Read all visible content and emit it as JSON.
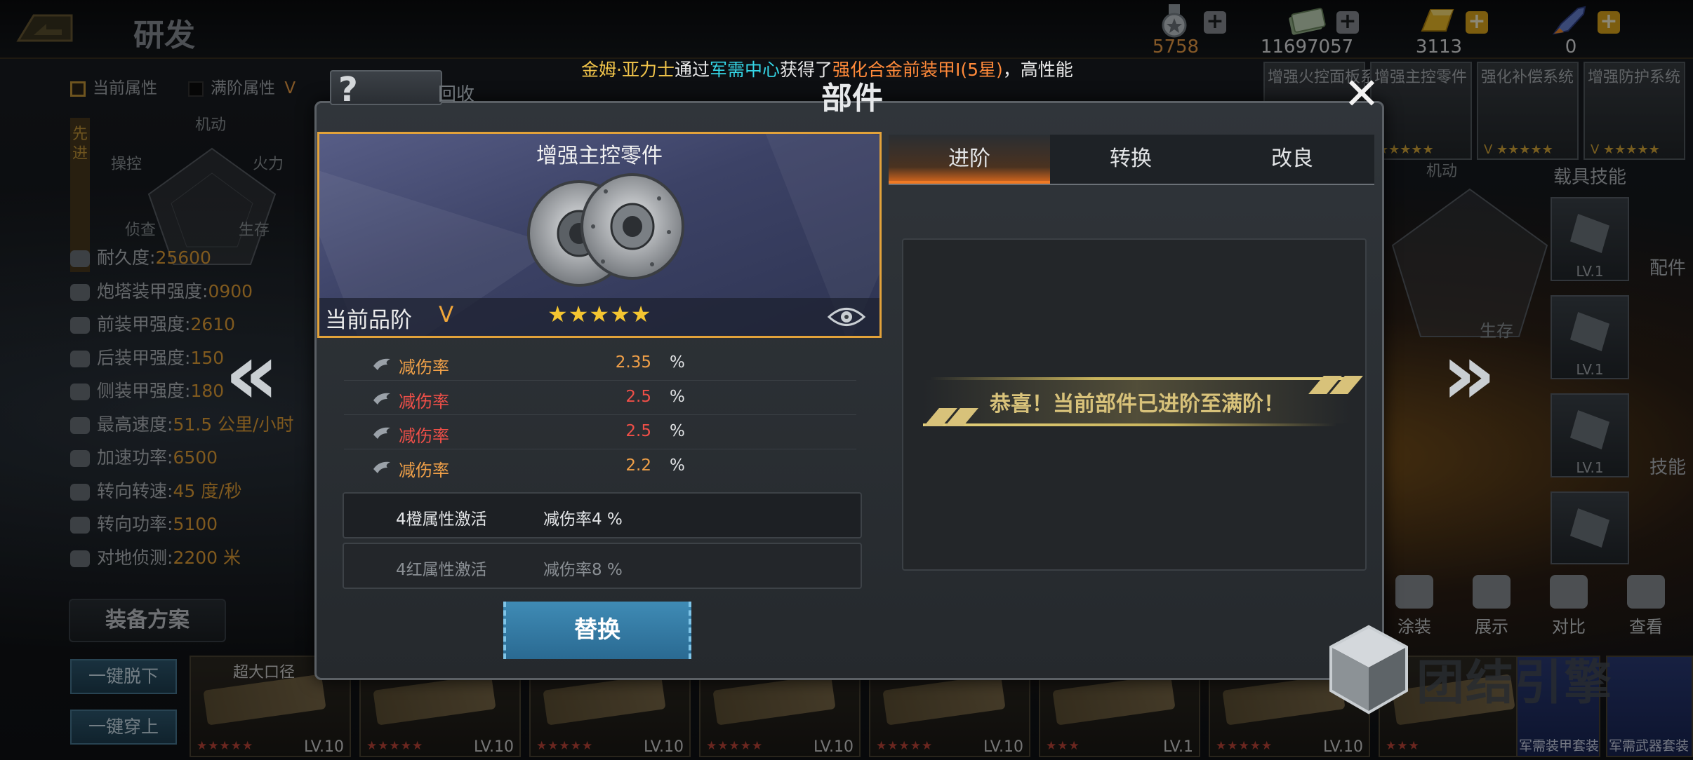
{
  "header": {
    "title": "研发"
  },
  "currencies": [
    {
      "icon": "medal-icon",
      "value": "5758"
    },
    {
      "icon": "cash-icon",
      "value": "11697057"
    },
    {
      "icon": "gold-bar-icon",
      "value": "3113"
    },
    {
      "icon": "rocket-icon",
      "value": "0"
    }
  ],
  "ticker": {
    "player": "金姆·亚力士",
    "via": "通过",
    "place": "军需中心",
    "got": "获得了",
    "item": "强化合金前装甲I(5星)",
    "tail": "，高性能"
  },
  "left_panel": {
    "tab_current": "当前属性",
    "tab_max": "满阶属性",
    "tab_max_grade": "V",
    "side_label": "先进",
    "radar_labels": {
      "top": "机动",
      "left": "操控",
      "right": "火力",
      "bottom_left": "侦查",
      "bottom_right": "生存"
    },
    "stats": [
      {
        "label": "耐久度:",
        "value": "25600"
      },
      {
        "label": "炮塔装甲强度:",
        "value": "0900"
      },
      {
        "label": "前装甲强度:",
        "value": "2610"
      },
      {
        "label": "后装甲强度:",
        "value": "150"
      },
      {
        "label": "侧装甲强度:",
        "value": "180"
      },
      {
        "label": "最高速度:",
        "value": "51.5 公里/小时"
      },
      {
        "label": "加速功率:",
        "value": "6500"
      },
      {
        "label": "转向转速:",
        "value": "45 度/秒"
      },
      {
        "label": "转向功率:",
        "value": "5100"
      },
      {
        "label": "对地侦测:",
        "value": "2200 米"
      }
    ],
    "equip_plan_label": "装备方案",
    "unequip_all": "一键脱下",
    "equip_all": "一键穿上"
  },
  "equipment": [
    {
      "label": "超大口径",
      "stars": "★★★★★",
      "level": "LV.10"
    },
    {
      "label": "",
      "stars": "★★★★★",
      "level": "LV.10"
    },
    {
      "label": "",
      "stars": "★★★★★",
      "level": "LV.10"
    },
    {
      "label": "",
      "stars": "★★★★★",
      "level": "LV.10"
    },
    {
      "label": "",
      "stars": "★★★★★",
      "level": "LV.10"
    },
    {
      "label": "",
      "stars": "★★★",
      "level": "LV.1"
    },
    {
      "label": "",
      "stars": "★★★★★",
      "level": "LV.10"
    },
    {
      "label": "",
      "stars": "★★★",
      "level": ""
    }
  ],
  "bottom_right_labels": {
    "armor_set": "军需装甲套装",
    "weapon_set": "军需武器套装"
  },
  "right_tiles": [
    {
      "title": "增强火控面板系统",
      "stars": ""
    },
    {
      "title": "增强主控零件",
      "stars": "★★★★★"
    },
    {
      "title": "强化补偿系统",
      "stars": "V ★★★★★"
    },
    {
      "title": "增强防护系统",
      "stars": "V ★★★★★"
    }
  ],
  "right_radar": {
    "top": "机动",
    "bottom_right": "生存"
  },
  "skills": {
    "title": "载具技能",
    "levels": [
      "LV.1",
      "LV.1",
      "LV.1"
    ]
  },
  "side_labels": {
    "parts": "配件",
    "skills": "技能"
  },
  "action_icons": [
    {
      "icon": "paint-icon",
      "label": "涂装"
    },
    {
      "icon": "showcase-icon",
      "label": "展示"
    },
    {
      "icon": "compare-icon",
      "label": "对比"
    },
    {
      "icon": "camera-icon",
      "label": "查看"
    }
  ],
  "modal": {
    "title": "部件",
    "recycle_label": "回收",
    "part": {
      "name": "增强主控零件",
      "grade_label": "当前品阶",
      "grade_value": "V",
      "stars": "★★★★★"
    },
    "attributes": [
      {
        "name": "减伤率",
        "value": "2.35",
        "unit": "%",
        "color": "orange"
      },
      {
        "name": "减伤率",
        "value": "2.5",
        "unit": "%",
        "color": "red"
      },
      {
        "name": "减伤率",
        "value": "2.5",
        "unit": "%",
        "color": "red"
      },
      {
        "name": "减伤率",
        "value": "2.2",
        "unit": "%",
        "color": "orange"
      }
    ],
    "bonuses": [
      {
        "label": "4橙属性激活",
        "value": "减伤率4 %",
        "active": true
      },
      {
        "label": "4红属性激活",
        "value": "减伤率8 %",
        "active": false
      }
    ],
    "replace_button": "替换",
    "tabs": [
      "进阶",
      "转换",
      "改良"
    ],
    "active_tab": 0,
    "max_message": "恭喜！当前部件已进阶至满阶！"
  },
  "watermark": {
    "text": "团结引擎"
  },
  "colors": {
    "accent_orange": "#f07a24",
    "gold": "#f4c531",
    "attr_orange": "#f0a048",
    "attr_red": "#ef4f48",
    "button_blue": "#3f8bb5"
  }
}
